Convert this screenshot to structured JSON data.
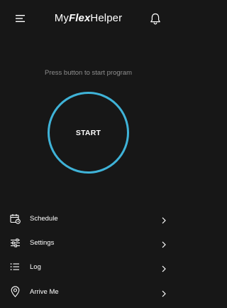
{
  "header": {
    "logo_prefix": "My",
    "logo_bold": "Flex",
    "logo_suffix": "Helper",
    "menu_icon": "hamburger-menu-icon",
    "notification_icon": "bell-icon"
  },
  "main": {
    "hint": "Press button to start program",
    "start_label": "START",
    "accent_color": "#3fb3d8"
  },
  "menu": {
    "items": [
      {
        "label": "Schedule",
        "icon": "calendar-clock-icon"
      },
      {
        "label": "Settings",
        "icon": "sliders-icon"
      },
      {
        "label": "Log",
        "icon": "list-icon"
      },
      {
        "label": "Arrive Me",
        "icon": "location-pin-icon"
      }
    ],
    "chevron_icon": "chevron-right-icon"
  }
}
